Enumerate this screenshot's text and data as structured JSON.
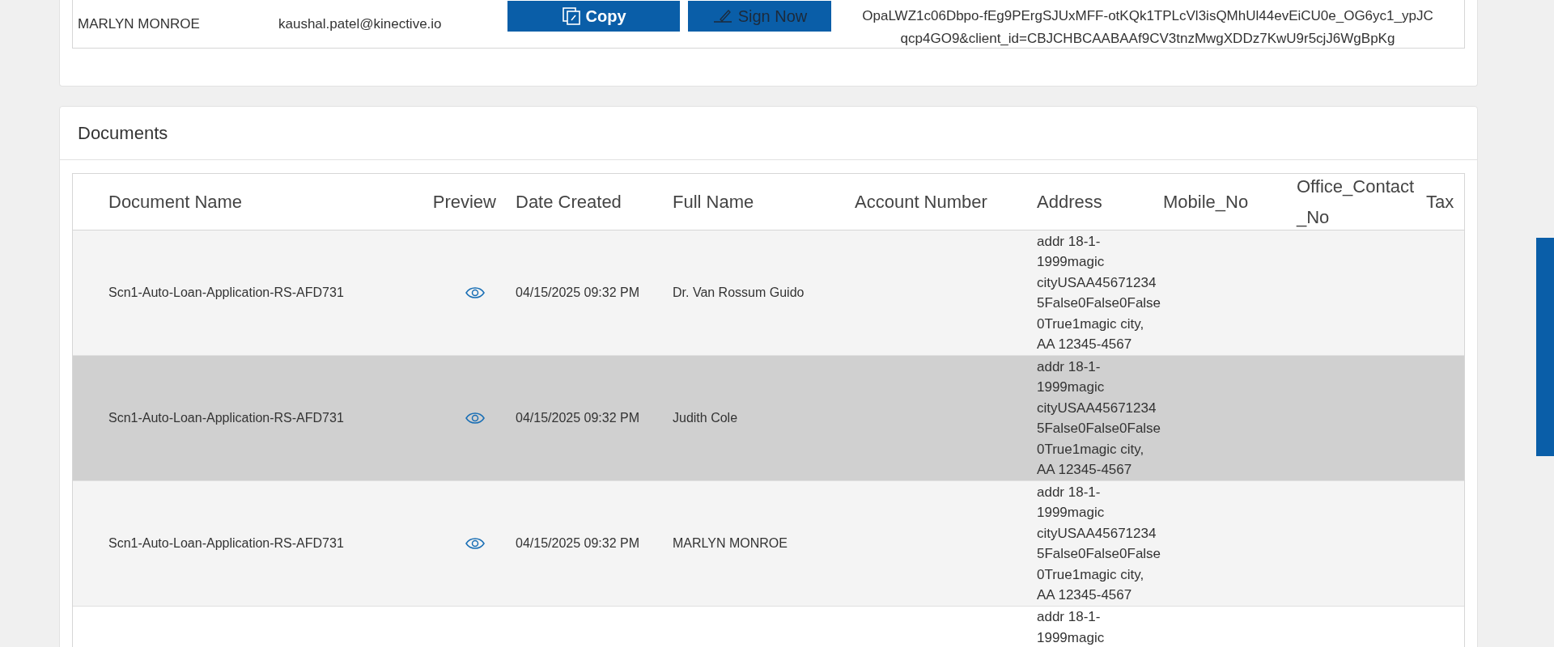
{
  "signers": {
    "rows": [
      {
        "name": "MARLYN MONROE",
        "email": "kaushal.patel@kinective.io",
        "copy_label": "Copy",
        "sign_label": "Sign Now",
        "url": "OpaLWZ1c06Dbpo-fEg9PErgSJUxMFF-otKQk1TPLcVl3isQMhUl44evEiCU0e_OG6yc1_ypJC\nqcp4GO9&client_id=CBJCHBCAABAAf9CV3tnzMwgXDDz7KwU9r5cjJ6WgBpKg"
      }
    ]
  },
  "documents": {
    "title": "Documents",
    "columns": [
      "Document Name",
      "Preview",
      "Date Created",
      "Full Name",
      "Account Number",
      "Address",
      "Mobile_No",
      "Office_Contact\n_No",
      "Tax"
    ],
    "rows": [
      {
        "selected": false,
        "document_name": "Scn1-Auto-Loan-Application-RS-AFD731",
        "date_created": "04/15/2025 09:32 PM",
        "full_name": "Dr. Van Rossum Guido",
        "address": "addr 18-1-\n1999magic\ncityUSAA45671234\n5False0False0False\n0True1magic city,\nAA 12345-4567"
      },
      {
        "selected": true,
        "document_name": "Scn1-Auto-Loan-Application-RS-AFD731",
        "date_created": "04/15/2025 09:32 PM",
        "full_name": "Judith Cole",
        "address": "addr 18-1-\n1999magic\ncityUSAA45671234\n5False0False0False\n0True1magic city,\nAA 12345-4567"
      },
      {
        "selected": false,
        "document_name": "Scn1-Auto-Loan-Application-RS-AFD731",
        "date_created": "04/15/2025 09:32 PM",
        "full_name": "MARLYN MONROE",
        "address": "addr 18-1-\n1999magic\ncityUSAA45671234\n5False0False0False\n0True1magic city,\nAA 12345-4567"
      },
      {
        "selected": false,
        "address": "addr 18-1-\n1999magic"
      }
    ]
  }
}
